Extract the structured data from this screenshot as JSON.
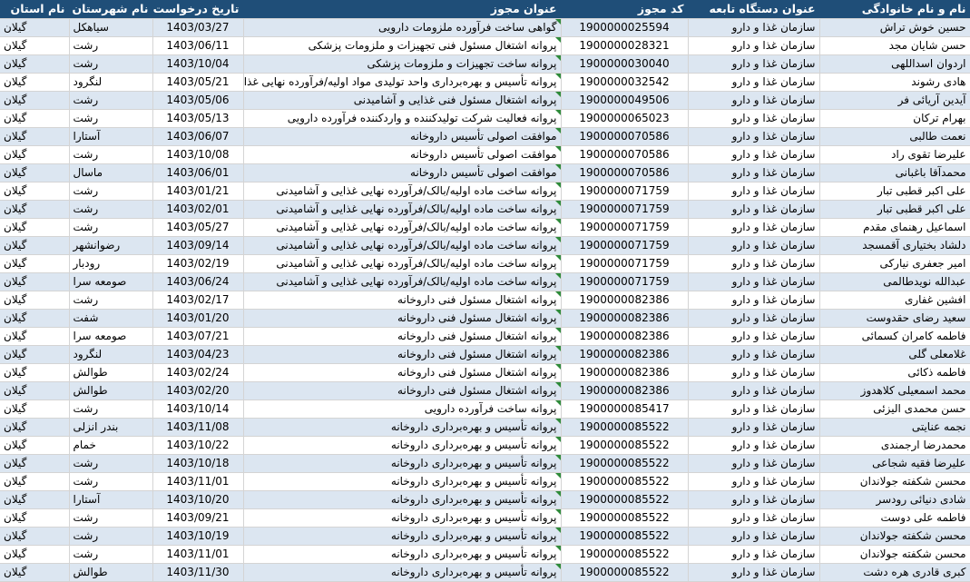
{
  "headers": {
    "name": "نام و نام خانوادگی",
    "org": "عنوان دستگاه تابعه",
    "code": "کد مجوز",
    "title": "عنوان مجوز",
    "date": "تاریخ درخواست",
    "city": "نام شهرستان",
    "province": "نام استان"
  },
  "rows": [
    {
      "name": "حسین خوش تراش",
      "org": "سازمان غذا و دارو",
      "code": "1900000025594",
      "title": "گواهی ساخت فرآورده ملزومات دارویی",
      "date": "1403/03/27",
      "city": "سیاهکل",
      "province": "گیلان"
    },
    {
      "name": "حسن شایان مجد",
      "org": "سازمان غذا و دارو",
      "code": "1900000028321",
      "title": "پروانه اشتغال مسئول فنی تجهیزات و ملزومات پزشکی",
      "date": "1403/06/11",
      "city": "رشت",
      "province": "گیلان"
    },
    {
      "name": "اردوان اسداللهی",
      "org": "سازمان غذا و دارو",
      "code": "1900000030040",
      "title": "پروانه ساخت تجهیزات و ملزومات پزشکی",
      "date": "1403/10/04",
      "city": "رشت",
      "province": "گیلان"
    },
    {
      "name": "هادی رشوند",
      "org": "سازمان غذا و دارو",
      "code": "1900000032542",
      "title": "پروانه تأسیس و بهره‌برداری واحد تولیدی مواد اولیه/فرآورده نهایی غذایی",
      "date": "1403/05/21",
      "city": "لنگرود",
      "province": "گیلان"
    },
    {
      "name": "آیدین آریائی فر",
      "org": "سازمان غذا و دارو",
      "code": "1900000049506",
      "title": "پروانه اشتغال مسئول فنی غذایی و آشامیدنی",
      "date": "1403/05/06",
      "city": "رشت",
      "province": "گیلان"
    },
    {
      "name": "بهرام ترکان",
      "org": "سازمان غذا و دارو",
      "code": "1900000065023",
      "title": "پروانه فعالیت شرکت تولیدکننده و واردکننده فرآورده دارویی",
      "date": "1403/05/13",
      "city": "رشت",
      "province": "گیلان"
    },
    {
      "name": "نعمت طالبی",
      "org": "سازمان غذا و دارو",
      "code": "1900000070586",
      "title": "موافقت اصولی تأسیس داروخانه",
      "date": "1403/06/07",
      "city": "آستارا",
      "province": "گیلان"
    },
    {
      "name": "علیرضا تقوی راد",
      "org": "سازمان غذا و دارو",
      "code": "1900000070586",
      "title": "موافقت اصولی تأسیس داروخانه",
      "date": "1403/10/08",
      "city": "رشت",
      "province": "گیلان"
    },
    {
      "name": "محمدآقا باغبانی",
      "org": "سازمان غذا و دارو",
      "code": "1900000070586",
      "title": "موافقت اصولی تأسیس داروخانه",
      "date": "1403/06/01",
      "city": "ماسال",
      "province": "گیلان"
    },
    {
      "name": "علی اکبر قطبی تبار",
      "org": "سازمان غذا و دارو",
      "code": "1900000071759",
      "title": "پروانه ساخت ماده اولیه/بالک/فرآورده نهایی غذایی و آشامیدنی",
      "date": "1403/01/21",
      "city": "رشت",
      "province": "گیلان"
    },
    {
      "name": "علی اکبر قطبی تبار",
      "org": "سازمان غذا و دارو",
      "code": "1900000071759",
      "title": "پروانه ساخت ماده اولیه/بالک/فرآورده نهایی غذایی و آشامیدنی",
      "date": "1403/02/01",
      "city": "رشت",
      "province": "گیلان"
    },
    {
      "name": "اسماعیل رهنمای مقدم",
      "org": "سازمان غذا و دارو",
      "code": "1900000071759",
      "title": "پروانه ساخت ماده اولیه/بالک/فرآورده نهایی غذایی و آشامیدنی",
      "date": "1403/05/27",
      "city": "رشت",
      "province": "گیلان"
    },
    {
      "name": "دلشاد بختیاری آقمسجد",
      "org": "سازمان غذا و دارو",
      "code": "1900000071759",
      "title": "پروانه ساخت ماده اولیه/بالک/فرآورده نهایی غذایی و آشامیدنی",
      "date": "1403/09/14",
      "city": "رضوانشهر",
      "province": "گیلان"
    },
    {
      "name": "امیر جعفری نیارکی",
      "org": "سازمان غذا و دارو",
      "code": "1900000071759",
      "title": "پروانه ساخت ماده اولیه/بالک/فرآورده نهایی غذایی و آشامیدنی",
      "date": "1403/02/19",
      "city": "رودبار",
      "province": "گیلان"
    },
    {
      "name": "عبدالله نویدطالمی",
      "org": "سازمان غذا و دارو",
      "code": "1900000071759",
      "title": "پروانه ساخت ماده اولیه/بالک/فرآورده نهایی غذایی و آشامیدنی",
      "date": "1403/06/24",
      "city": "صومعه سرا",
      "province": "گیلان"
    },
    {
      "name": "افشین غفاری",
      "org": "سازمان غذا و دارو",
      "code": "1900000082386",
      "title": "پروانه اشتغال مسئول فنی داروخانه",
      "date": "1403/02/17",
      "city": "رشت",
      "province": "گیلان"
    },
    {
      "name": "سعید رضای حقدوست",
      "org": "سازمان غذا و دارو",
      "code": "1900000082386",
      "title": "پروانه اشتغال مسئول فنی داروخانه",
      "date": "1403/01/20",
      "city": "شفت",
      "province": "گیلان"
    },
    {
      "name": "فاطمه کامران کسمائی",
      "org": "سازمان غذا و دارو",
      "code": "1900000082386",
      "title": "پروانه اشتغال مسئول فنی داروخانه",
      "date": "1403/07/21",
      "city": "صومعه سرا",
      "province": "گیلان"
    },
    {
      "name": "غلامعلی گلی",
      "org": "سازمان غذا و دارو",
      "code": "1900000082386",
      "title": "پروانه اشتغال مسئول فنی داروخانه",
      "date": "1403/04/23",
      "city": "لنگرود",
      "province": "گیلان"
    },
    {
      "name": "فاطمه ذکائی",
      "org": "سازمان غذا و دارو",
      "code": "1900000082386",
      "title": "پروانه اشتغال مسئول فنی داروخانه",
      "date": "1403/02/24",
      "city": "طوالش",
      "province": "گیلان"
    },
    {
      "name": "محمد اسمعیلی کلاهدوز",
      "org": "سازمان غذا و دارو",
      "code": "1900000082386",
      "title": "پروانه اشتغال مسئول فنی داروخانه",
      "date": "1403/02/20",
      "city": "طوالش",
      "province": "گیلان"
    },
    {
      "name": "حسن محمدی الیزئی",
      "org": "سازمان غذا و دارو",
      "code": "1900000085417",
      "title": "پروانه ساخت فرآورده دارویی",
      "date": "1403/10/14",
      "city": "رشت",
      "province": "گیلان"
    },
    {
      "name": "نجمه عنایتی",
      "org": "سازمان غذا و دارو",
      "code": "1900000085522",
      "title": "پروانه تأسیس و بهره‌برداری داروخانه",
      "date": "1403/11/08",
      "city": "بندر انزلی",
      "province": "گیلان"
    },
    {
      "name": "محمدرضا ارجمندی",
      "org": "سازمان غذا و دارو",
      "code": "1900000085522",
      "title": "پروانه تأسیس و بهره‌برداری داروخانه",
      "date": "1403/10/22",
      "city": "خمام",
      "province": "گیلان"
    },
    {
      "name": "علیرضا فقیه شجاعی",
      "org": "سازمان غذا و دارو",
      "code": "1900000085522",
      "title": "پروانه تأسیس و بهره‌برداری داروخانه",
      "date": "1403/10/18",
      "city": "رشت",
      "province": "گیلان"
    },
    {
      "name": "محسن شکفته جولاندان",
      "org": "سازمان غذا و دارو",
      "code": "1900000085522",
      "title": "پروانه تأسیس و بهره‌برداری داروخانه",
      "date": "1403/11/01",
      "city": "رشت",
      "province": "گیلان"
    },
    {
      "name": "شادی دنیائی رودسر",
      "org": "سازمان غذا و دارو",
      "code": "1900000085522",
      "title": "پروانه تأسیس و بهره‌برداری داروخانه",
      "date": "1403/10/20",
      "city": "آستارا",
      "province": "گیلان"
    },
    {
      "name": "فاطمه علی دوست",
      "org": "سازمان غذا و دارو",
      "code": "1900000085522",
      "title": "پروانه تأسیس و بهره‌برداری داروخانه",
      "date": "1403/09/21",
      "city": "رشت",
      "province": "گیلان"
    },
    {
      "name": "محسن شکفته جولاندان",
      "org": "سازمان غذا و دارو",
      "code": "1900000085522",
      "title": "پروانه تأسیس و بهره‌برداری داروخانه",
      "date": "1403/10/19",
      "city": "رشت",
      "province": "گیلان"
    },
    {
      "name": "محسن شکفته جولاندان",
      "org": "سازمان غذا و دارو",
      "code": "1900000085522",
      "title": "پروانه تأسیس و بهره‌برداری داروخانه",
      "date": "1403/11/01",
      "city": "رشت",
      "province": "گیلان"
    },
    {
      "name": "کبری قادری هره دشت",
      "org": "سازمان غذا و دارو",
      "code": "1900000085522",
      "title": "پروانه تأسیس و بهره‌برداری داروخانه",
      "date": "1403/11/30",
      "city": "طوالش",
      "province": "گیلان"
    }
  ]
}
